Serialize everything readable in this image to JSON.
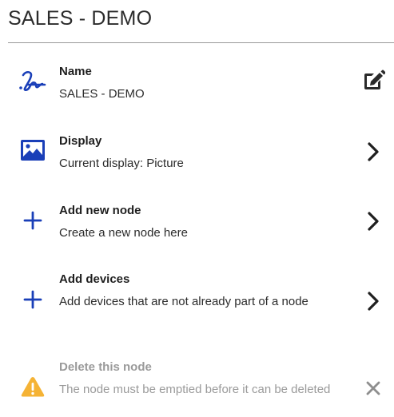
{
  "header": {
    "title": "SALES - DEMO"
  },
  "items": [
    {
      "title": "Name",
      "subtitle": "SALES - DEMO",
      "icon": "signature-icon",
      "action_icon": "edit-icon",
      "enabled": true
    },
    {
      "title": "Display",
      "subtitle": "Current display: Picture",
      "icon": "image-icon",
      "action_icon": "chevron-right-icon",
      "enabled": true
    },
    {
      "title": "Add new node",
      "subtitle": "Create a new node here",
      "icon": "plus-icon",
      "action_icon": "chevron-right-icon",
      "enabled": true
    },
    {
      "title": "Add devices",
      "subtitle": "Add devices that are not already part of a node",
      "icon": "plus-icon",
      "action_icon": "chevron-right-icon",
      "enabled": true
    },
    {
      "title": "Delete this node",
      "subtitle": "The node must be emptied before it can be deleted",
      "icon": "warning-icon",
      "action_icon": "close-icon",
      "enabled": false
    }
  ],
  "colors": {
    "accent": "#1a3fb8",
    "warning": "#f5b335",
    "disabled_text": "#9a9a9a",
    "dark_icon": "#2a2a2a"
  }
}
